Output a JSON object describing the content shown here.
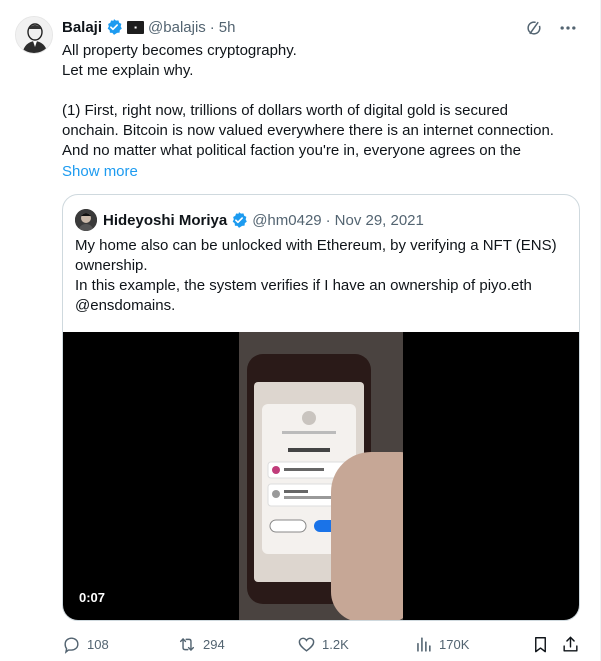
{
  "author": {
    "name": "Balaji",
    "handle": "@balajis",
    "time": "5h"
  },
  "tweet": {
    "lines": [
      "All property becomes cryptography.",
      "Let me explain why.",
      "",
      "(1) First, right now, trillions of dollars worth of digital gold is secured",
      "onchain. Bitcoin is now valued everywhere there is an internet connection.",
      "And no matter what political faction you're in, everyone agrees on the"
    ],
    "show_more": "Show more"
  },
  "quote": {
    "name": "Hideyoshi Moriya",
    "handle": "@hm0429",
    "date": "Nov 29, 2021",
    "lines": [
      "My home also can be unlocked with Ethereum, by verifying a NFT (ENS)",
      "ownership.",
      "In this example, the system verifies if I have an ownership of piyo.eth",
      "@ensdomains."
    ],
    "video_time": "0:07"
  },
  "actions": {
    "replies": "108",
    "reposts": "294",
    "likes": "1.2K",
    "views": "170K"
  },
  "colors": {
    "accent": "#1d9bf0",
    "muted": "#536471",
    "text": "#0f1419"
  }
}
